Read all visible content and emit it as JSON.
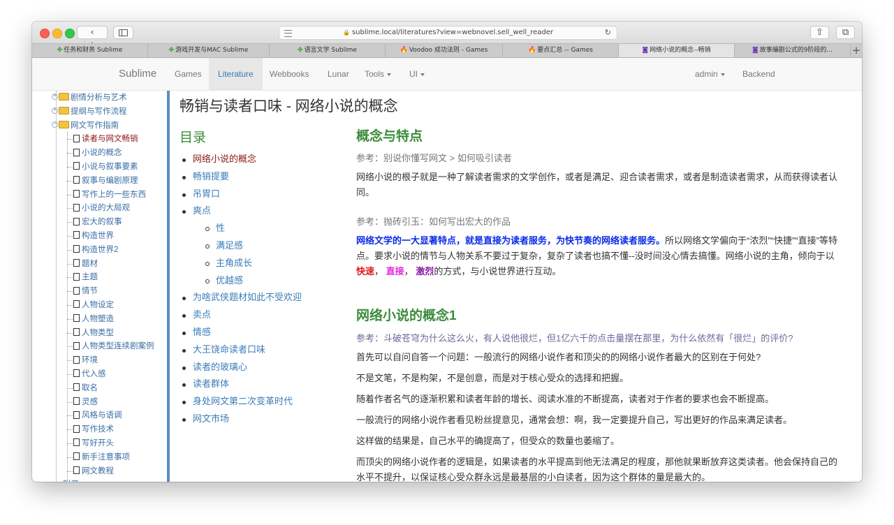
{
  "browser": {
    "back_glyph": "‹",
    "forward_glyph": "›",
    "url": "sublime.local/literatures?view=webnovel.sell_well_reader",
    "lock_glyph": "🔒",
    "reload_glyph": "↻",
    "share_glyph": "⇧",
    "tabs_glyph": "⧉",
    "tabs": [
      {
        "icon": "✤",
        "icon_color": "#3a9a3a",
        "label": "任务和财务 Sublime"
      },
      {
        "icon": "✤",
        "icon_color": "#3a9a3a",
        "label": "游戏开发与MAC Sublime"
      },
      {
        "icon": "✤",
        "icon_color": "#3a9a3a",
        "label": "语言文学 Sublime"
      },
      {
        "icon": "🔥",
        "icon_color": "#e4572e",
        "label": "Voodoo 成功法则 - Games"
      },
      {
        "icon": "🔥",
        "icon_color": "#e4572e",
        "label": "要点汇总 -- Games"
      },
      {
        "icon": "◙",
        "icon_color": "#6b3aa6",
        "label": "网络小说的概念--畅销"
      },
      {
        "icon": "◙",
        "icon_color": "#6b3aa6",
        "label": "故事编剧公式的9阶段的..."
      }
    ],
    "add_tab_glyph": "+"
  },
  "navbar": {
    "brand": "Sublime",
    "items": {
      "games": "Games",
      "literature": "Literature",
      "webbooks": "Webbooks",
      "lunar": "Lunar",
      "tools": "Tools",
      "ui": "UI",
      "admin": "admin",
      "backend": "Backend"
    }
  },
  "tree": {
    "folders": [
      "剧情分析与艺术",
      "提纲与写作流程",
      "网文写作指南"
    ],
    "plus_glyph": "+",
    "minus_glyph": "−",
    "docs": [
      "读者与网文畅销",
      "小说的概念",
      "小说与叙事要素",
      "叙事与编剧原理",
      "写作上的一些东西",
      "小说的大局观",
      "宏大的叙事",
      "构造世界",
      "构造世界2",
      "题材",
      "主题",
      "情节",
      "人物设定",
      "人物塑造",
      "人物类型",
      "人物类型连续剧案例",
      "环境",
      "代入感",
      "取名",
      "灵感",
      "风格与语调",
      "写作技术",
      "写好开头",
      "新手注意事项",
      "网文教程"
    ],
    "partial_last": "附录"
  },
  "page_title": "畅销与读者口味 - 网络小说的概念",
  "toc": {
    "title": "目录",
    "items": [
      {
        "label": "网络小说的概念",
        "level": 1
      },
      {
        "label": "畅销提要",
        "level": 1
      },
      {
        "label": "吊胃口",
        "level": 1
      },
      {
        "label": "爽点",
        "level": 1
      },
      {
        "label": "性",
        "level": 2
      },
      {
        "label": "满足感",
        "level": 2
      },
      {
        "label": "主角成长",
        "level": 2
      },
      {
        "label": "优越感",
        "level": 2
      },
      {
        "label": "为啥武侠题材如此不受欢迎",
        "level": 1
      },
      {
        "label": "卖点",
        "level": 1
      },
      {
        "label": "情感",
        "level": 1
      },
      {
        "label": "大王饶命读者口味",
        "level": 1
      },
      {
        "label": "读者的玻璃心",
        "level": 1
      },
      {
        "label": "读者群体",
        "level": 1
      },
      {
        "label": "身处网文第二次变革时代",
        "level": 1
      },
      {
        "label": "网文市场",
        "level": 1
      }
    ]
  },
  "article": {
    "section1": {
      "heading": "概念与特点",
      "ref1": "参考：别说你懂写网文 > 如何吸引读者",
      "para1": "网络小说的根子就是一种了解读者需求的文学创作，或者是满足、迎合读者需求，或者是制造读者需求，从而获得读者认同。",
      "ref2": "参考：抛砖引玉：如何写出宏大的作品",
      "para2_strong": "网络文学的一大显著特点，就是直接为读者服务，为快节奏的网络读者服务。",
      "para2_rest": "所以网络文学偏向于“浓烈”“快捷”“直接”等特点。要求小说的情节与人物关系不要过于复杂，复杂了读者也搞不懂--没时间没心情去搞懂。网络小说的主角，倾向于以",
      "kw1": "快速",
      "sep1": "，",
      "kw2": "直接",
      "sep2": "，",
      "kw3": "激烈",
      "para2_end": "的方式，与小说世界进行互动。"
    },
    "section2": {
      "heading": "网络小说的概念1",
      "ref": "参考：斗破苍穹为什么这么火，有人说他很烂，但1亿六千的点击量摆在那里，为什么依然有「很烂」的评价?",
      "paras": [
        "首先可以自问自答一个问题：一般流行的网络小说作者和顶尖的的网络小说作者最大的区别在于何处?",
        "不是文笔，不是构架，不是创意，而是对于核心受众的选择和把握。",
        "随着作者名气的逐渐积累和读者年龄的增长、阅读水准的不断提高，读者对于作者的要求也会不断提高。",
        "一般流行的网络小说作者看见粉丝提意见，通常会想：啊，我一定要提升自己，写出更好的作品来满足读者。",
        "这样做的结果是，自己水平的确提高了，但受众的数量也萎缩了。",
        "而顶尖的网络小说作者的逻辑是，如果读者的水平提高到他无法满足的程度，那他就果断放弃这类读者。他会保持自己的水平不提升，以保证核心受众群永远是最基层的小白读者，因为这个群体的量是最大的。"
      ]
    }
  }
}
